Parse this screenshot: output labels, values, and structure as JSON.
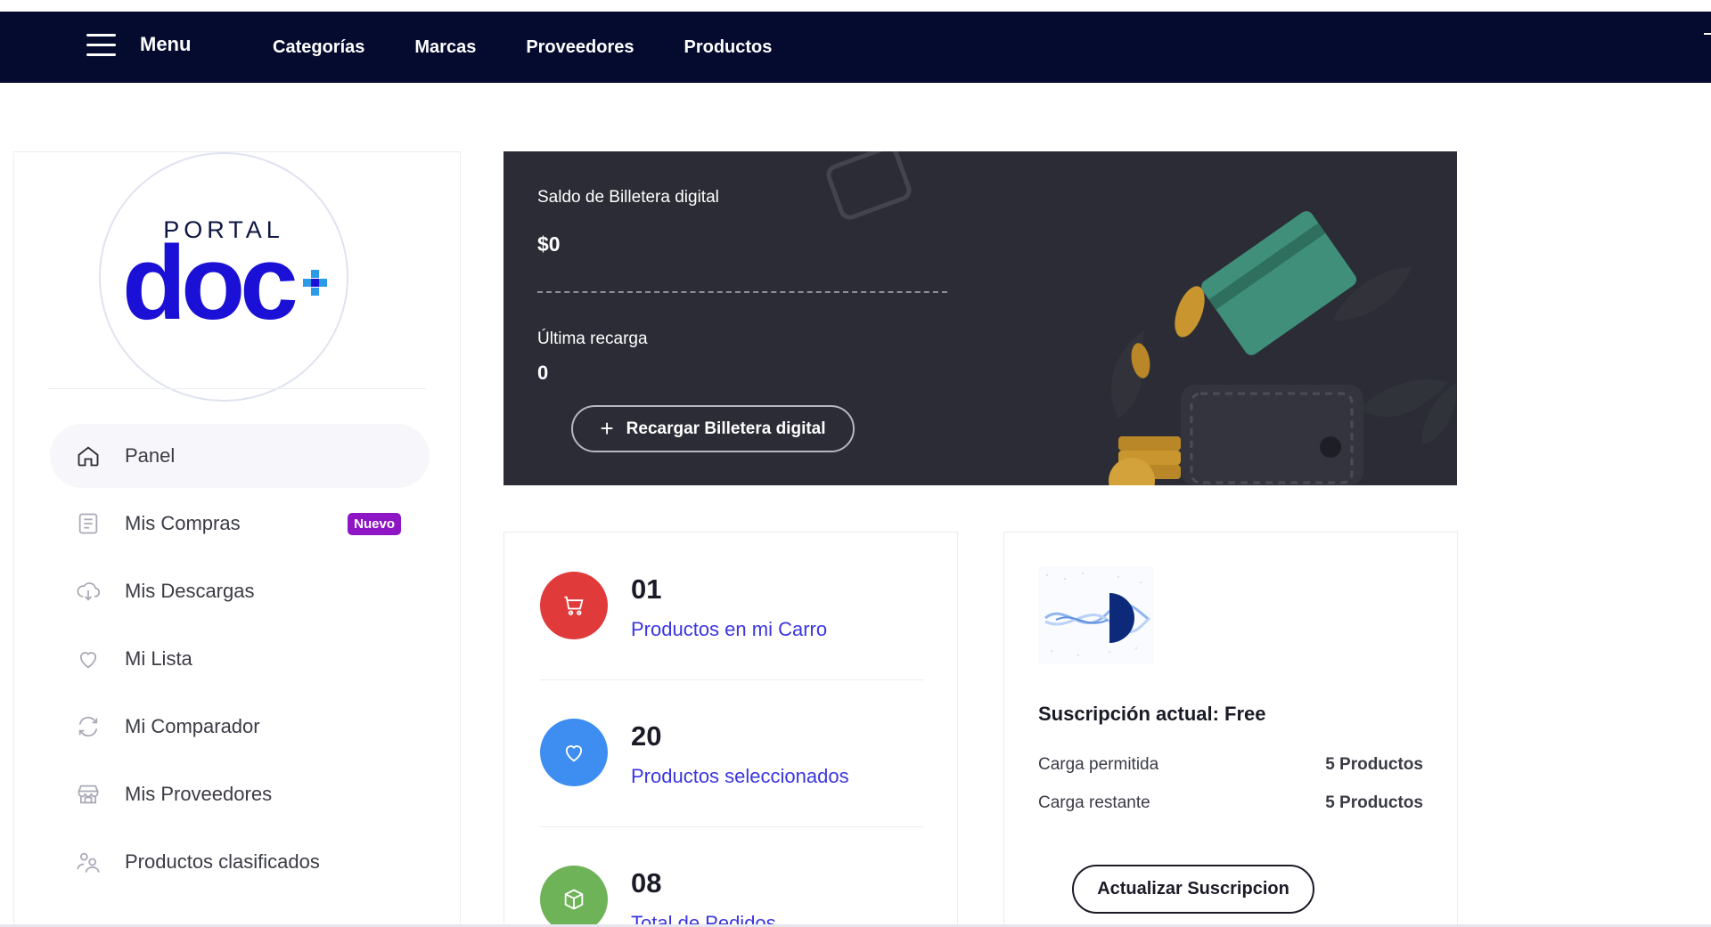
{
  "topbar": {
    "menu_label": "Menu",
    "nav": [
      "Categorías",
      "Marcas",
      "Proveedores",
      "Productos"
    ]
  },
  "logo": {
    "top_text": "PORTAL",
    "main_text": "doc",
    "brand_color": "#1b10d6",
    "accent_color": "#2b9be8"
  },
  "sidebar": {
    "items": [
      {
        "label": "Panel",
        "icon": "home-icon",
        "active": true
      },
      {
        "label": "Mis Compras",
        "icon": "receipt-icon",
        "badge": "Nuevo"
      },
      {
        "label": "Mis Descargas",
        "icon": "cloud-download-icon"
      },
      {
        "label": "Mi Lista",
        "icon": "heart-icon"
      },
      {
        "label": "Mi Comparador",
        "icon": "refresh-icon"
      },
      {
        "label": "Mis Proveedores",
        "icon": "store-icon"
      },
      {
        "label": "Productos clasificados",
        "icon": "users-icon"
      }
    ]
  },
  "wallet": {
    "title": "Saldo de Billetera digital",
    "amount": "$0",
    "last_label": "Última recarga",
    "last_value": "0",
    "button_label": "Recargar Billetera digital",
    "background": "#2b2c35"
  },
  "stats": [
    {
      "number": "01",
      "label": "Productos en mi Carro",
      "icon": "cart-icon",
      "color": "#e03a3a"
    },
    {
      "number": "20",
      "label": "Productos seleccionados",
      "icon": "heart-icon",
      "color": "#3d8ef0"
    },
    {
      "number": "08",
      "label": "Total de Pedidos",
      "icon": "package-icon",
      "color": "#6fb358"
    }
  ],
  "subscription": {
    "title": "Suscripción actual: Free",
    "rows": [
      {
        "label": "Carga permitida",
        "value": "5 Productos"
      },
      {
        "label": "Carga restante",
        "value": "5 Productos"
      }
    ],
    "button_label": "Actualizar Suscripcion"
  }
}
